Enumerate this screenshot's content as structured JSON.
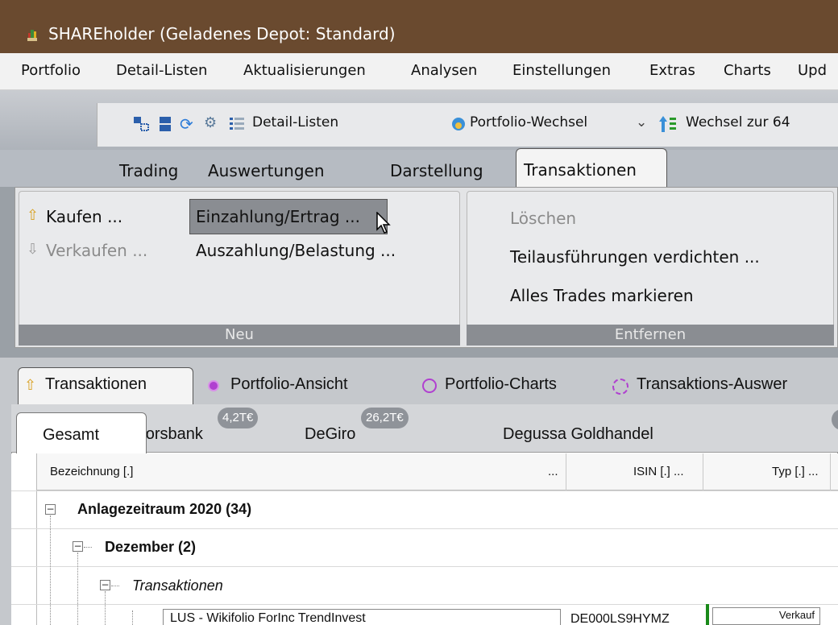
{
  "window": {
    "title": "SHAREholder (Geladenes Depot: Standard)"
  },
  "menu": {
    "items": [
      "Portfolio",
      "Detail-Listen",
      "Aktualisierungen",
      "Analysen",
      "Einstellungen",
      "Extras",
      "Charts",
      "Upd"
    ]
  },
  "toolbar": {
    "detail_listen": "Detail-Listen",
    "portfolio_wechsel": "Portfolio-Wechsel",
    "wechsel_zur": "Wechsel zur 64"
  },
  "ribbon_tabs": [
    "Trading",
    "Auswertungen",
    "Darstellung",
    "Transaktionen"
  ],
  "ribbon": {
    "neu": {
      "caption": "Neu",
      "kaufen": "Kaufen ...",
      "verkaufen": "Verkaufen ...",
      "einzahlung": "Einzahlung/Ertrag ...",
      "auszahlung": "Auszahlung/Belastung ..."
    },
    "entfernen": {
      "caption": "Entfernen",
      "loeschen": "Löschen",
      "teilausfuehrungen": "Teilausführungen verdichten ...",
      "alles_trades": "Alles Trades markieren"
    }
  },
  "view_tabs": [
    "Transaktionen",
    "Portfolio-Ansicht",
    "Portfolio-Charts",
    "Transaktions-Auswer"
  ],
  "depot_tabs": [
    {
      "label": "Gesamt",
      "badge": ""
    },
    {
      "label": "Consorsbank",
      "badge": "4,2T€"
    },
    {
      "label": "DeGiro",
      "badge": "26,2T€"
    },
    {
      "label": "Degussa Goldhandel",
      "badge": ""
    }
  ],
  "grid": {
    "columns": {
      "bezeichnung": "Bezeichnung [.]",
      "bezeichnung_more": "...",
      "isin": "ISIN [.] ...",
      "typ": "Typ [.] ..."
    },
    "tree": {
      "anlagezeitraum": "Anlagezeitraum 2020 (34)",
      "dezember": "Dezember (2)",
      "transaktionen": "Transaktionen",
      "row_bezeichnung": "LUS - Wikifolio ForInc TrendInvest",
      "row_isin": "DE000LS9HYMZ",
      "row_typ": "Verkauf"
    }
  },
  "colors": {
    "titlebar": "#6a4a2f",
    "selected_item": "#8a8d92",
    "sell_indicator": "#1a8a1a"
  }
}
